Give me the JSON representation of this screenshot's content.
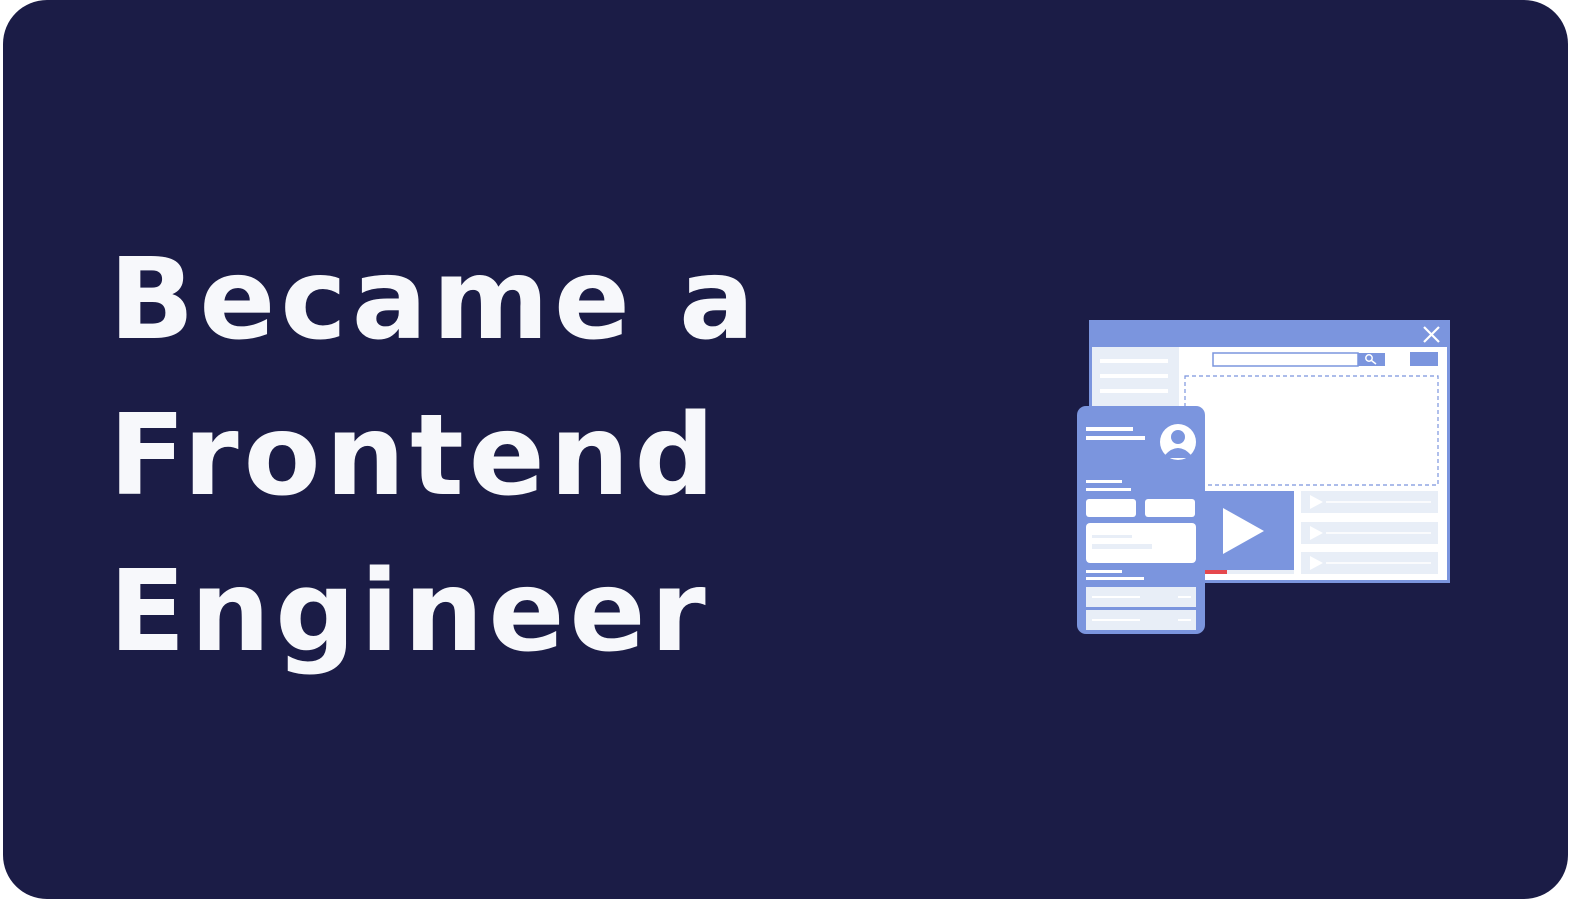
{
  "colors": {
    "background": "#1b1c46",
    "text": "#f7f8fb",
    "accent": "#7b95de",
    "panel_light": "#e8eef7",
    "white": "#ffffff",
    "progress_red": "#e5484d"
  },
  "headline": {
    "lines": [
      "Became a",
      "Frontend",
      "Engineer"
    ]
  },
  "illustration": {
    "icons": [
      "close-icon",
      "search-icon",
      "play-icon",
      "avatar-icon"
    ],
    "video_progress": 0.35
  }
}
